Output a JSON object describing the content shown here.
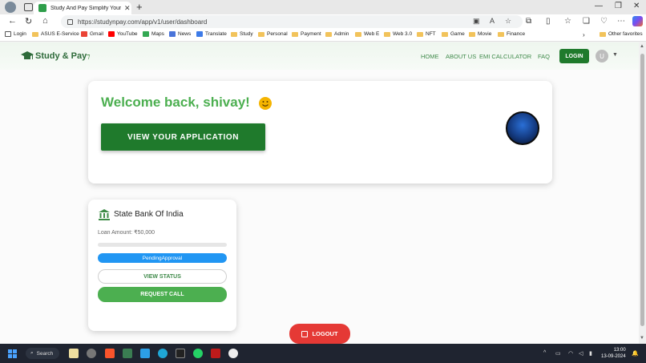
{
  "browser": {
    "tab_title": "Study And Pay Simplify Your Edu",
    "url": "https://studynpay.com/app/v1/user/dashboard",
    "favorites": [
      "Login",
      "ASUS E-Service",
      "Gmail",
      "YouTube",
      "Maps",
      "News",
      "Translate",
      "Study",
      "Personal",
      "Payment",
      "Admin",
      "Web E",
      "Web 3.0",
      "NFT",
      "Game",
      "Movie",
      "Finance"
    ],
    "other_favorites": "Other favorites"
  },
  "site": {
    "logo_text": "Study & Pay",
    "nav": [
      "HOME",
      "ABOUT US",
      "EMI CALCULATOR",
      "FAQ"
    ],
    "login_label": "LOGIN",
    "avatar_letter": "U"
  },
  "welcome": {
    "title": "Welcome back, shivay!",
    "button_label": "VIEW YOUR APPLICATION"
  },
  "application": {
    "bank_name": "State Bank Of India",
    "loan_amount": "Loan Amount: ₹50,000",
    "progress_fraction": 0,
    "status": "PendingApproval",
    "view_status_label": "VIEW STATUS",
    "request_call_label": "REQUEST CALL"
  },
  "logout_label": "LOGOUT",
  "taskbar": {
    "search_label": "Search",
    "time": "13:00",
    "date": "13-09-2024"
  },
  "colors": {
    "brand_green": "#4caf50",
    "dark_green": "#1f7a2c",
    "status_blue": "#2196f3",
    "logout_red": "#e53935"
  }
}
